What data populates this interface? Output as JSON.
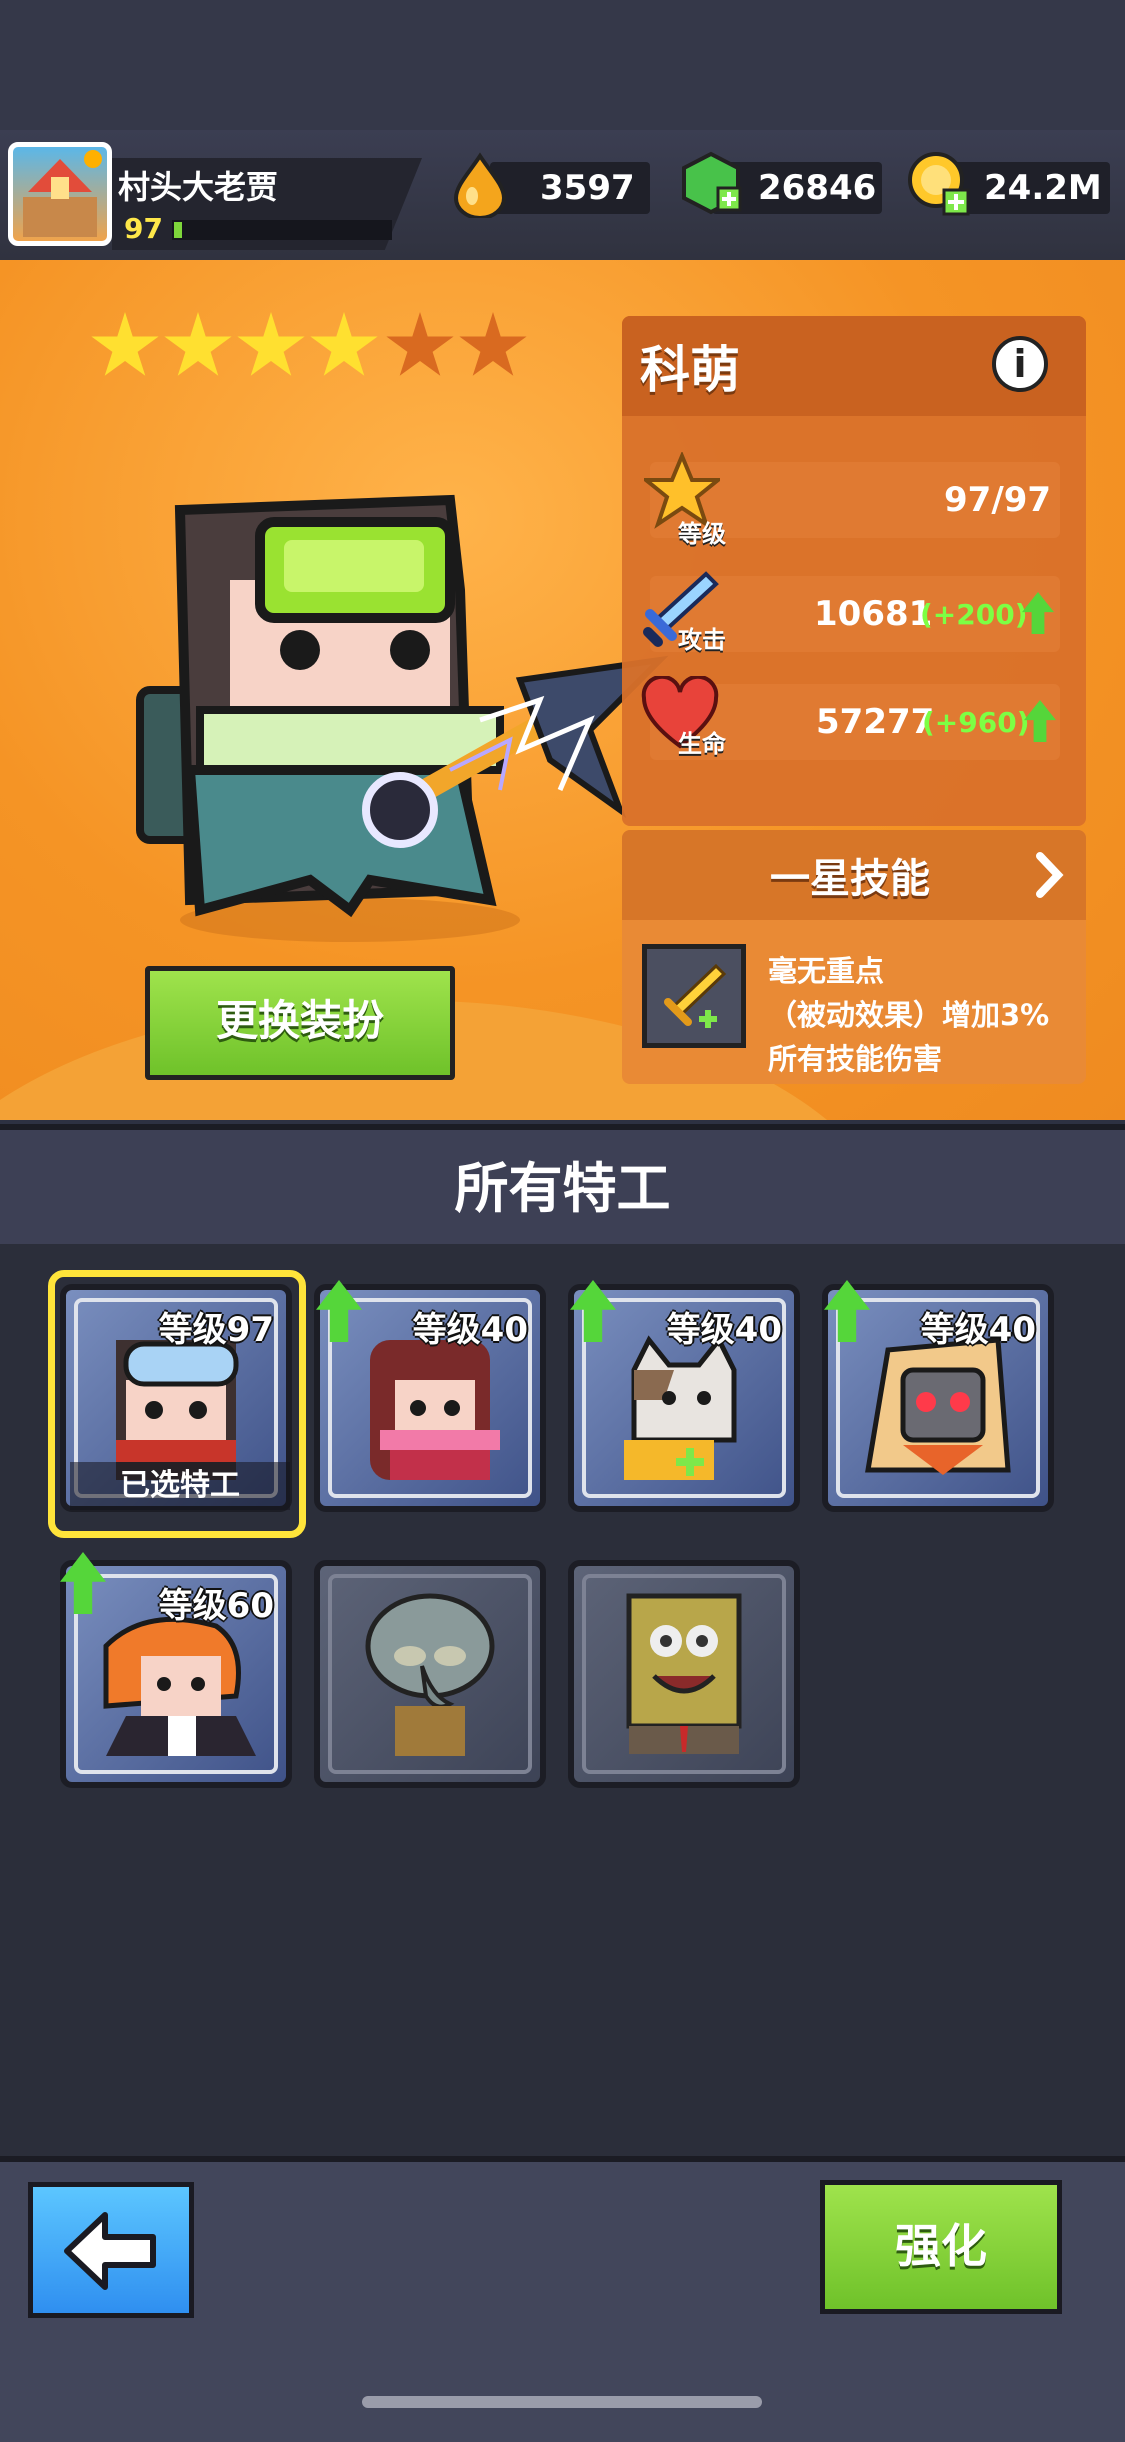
{
  "player": {
    "name": "村头大老贾",
    "level": "97"
  },
  "currency": {
    "oil": {
      "icon": "oil-drop-icon",
      "value": "3597"
    },
    "gems": {
      "icon": "green-gem-icon",
      "value": "26846"
    },
    "coins": {
      "icon": "gold-coin-icon",
      "value": "24.2M"
    }
  },
  "hero": {
    "stars_filled": 4,
    "stars_total": 6,
    "name": "科萌",
    "stats": {
      "level_label": "等级",
      "level_value": "97/97",
      "attack_label": "攻击",
      "attack_value": "10681",
      "attack_bonus": "(+200)",
      "hp_label": "生命",
      "hp_value": "57277",
      "hp_bonus": "(+960)"
    },
    "skill": {
      "title": "一星技能",
      "lines": [
        "毫无重点",
        "（被动效果）增加3%",
        "所有技能伤害"
      ]
    },
    "change_outfit_label": "更换装扮"
  },
  "agents": {
    "title": "所有特工",
    "selected_label": "已选特工",
    "cards": [
      {
        "level": "等级97",
        "selected": true,
        "upgrade": false,
        "locked": false
      },
      {
        "level": "等级40",
        "selected": false,
        "upgrade": true,
        "locked": false
      },
      {
        "level": "等级40",
        "selected": false,
        "upgrade": true,
        "locked": false
      },
      {
        "level": "等级40",
        "selected": false,
        "upgrade": true,
        "locked": false
      },
      {
        "level": "等级60",
        "selected": false,
        "upgrade": true,
        "locked": false
      },
      {
        "level": "",
        "selected": false,
        "upgrade": false,
        "locked": true
      },
      {
        "level": "",
        "selected": false,
        "upgrade": false,
        "locked": true
      }
    ]
  },
  "footer": {
    "back_icon": "back-arrow-icon",
    "enhance_label": "强化"
  },
  "colors": {
    "accent_orange": "#f59425",
    "button_green": "#6fc22a",
    "button_blue": "#2f8ff0",
    "selected_yellow": "#ffe43a"
  }
}
